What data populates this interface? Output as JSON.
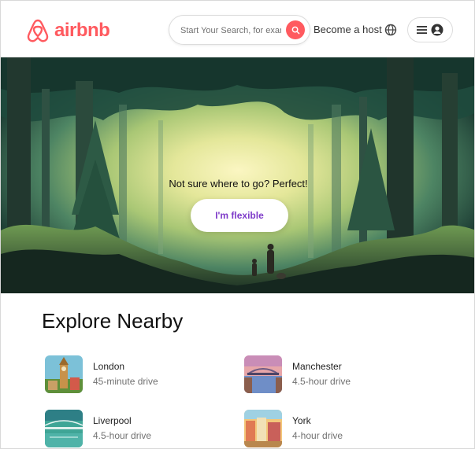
{
  "header": {
    "logo_text": "airbnb",
    "search_placeholder": "Start Your Search, for example",
    "host_link": "Become a host",
    "icons": {
      "logo": "airbnb-logo-icon",
      "search": "search-icon",
      "globe": "globe-icon",
      "menu": "menu-icon",
      "profile": "user-profile-icon"
    },
    "accent_color": "#ff5a5f"
  },
  "hero": {
    "tagline": "Not sure where to go? Perfect!",
    "cta_label": "I'm flexible",
    "cta_color": "#7e3bc9"
  },
  "explore": {
    "title": "Explore Nearby",
    "items": [
      {
        "city": "London",
        "drive": "45-minute drive"
      },
      {
        "city": "Manchester",
        "drive": "4.5-hour drive"
      },
      {
        "city": "Liverpool",
        "drive": "4.5-hour drive"
      },
      {
        "city": "York",
        "drive": "4-hour drive"
      }
    ]
  }
}
